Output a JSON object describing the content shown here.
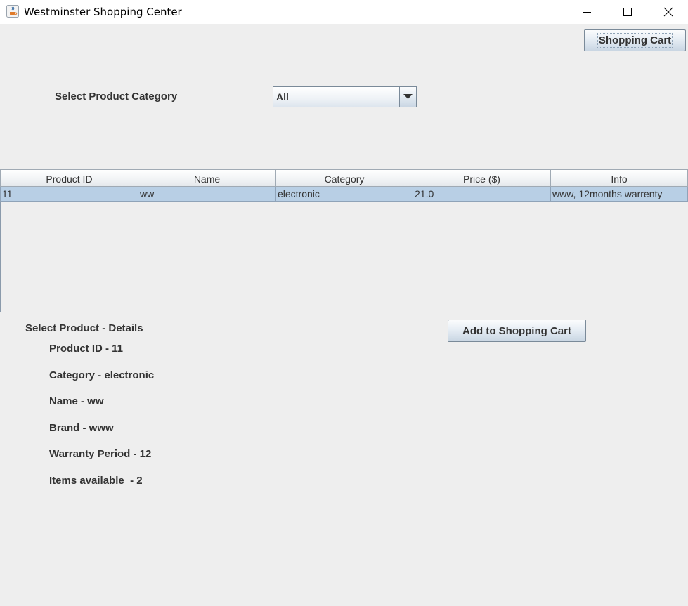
{
  "window": {
    "title": "Westminster Shopping Center",
    "icon": "java-cup-icon"
  },
  "toolbar": {
    "shopping_cart_label": "Shopping Cart"
  },
  "category": {
    "label": "Select Product Category",
    "selected": "All"
  },
  "table": {
    "columns": [
      "Product ID",
      "Name",
      "Category",
      "Price ($)",
      "Info"
    ],
    "rows": [
      [
        "11",
        "ww",
        "electronic",
        "21.0",
        "www, 12months warrenty"
      ]
    ],
    "selection_color": "#b8cfe5"
  },
  "details": {
    "title": "Select Product - Details",
    "product_id": "Product ID - 11",
    "category": "Category - electronic",
    "name": "Name - ww",
    "brand": "Brand - www",
    "warranty": "Warranty Period - 12",
    "items_available": "Items available  - 2"
  },
  "actions": {
    "add_to_cart_label": "Add to Shopping Cart"
  }
}
